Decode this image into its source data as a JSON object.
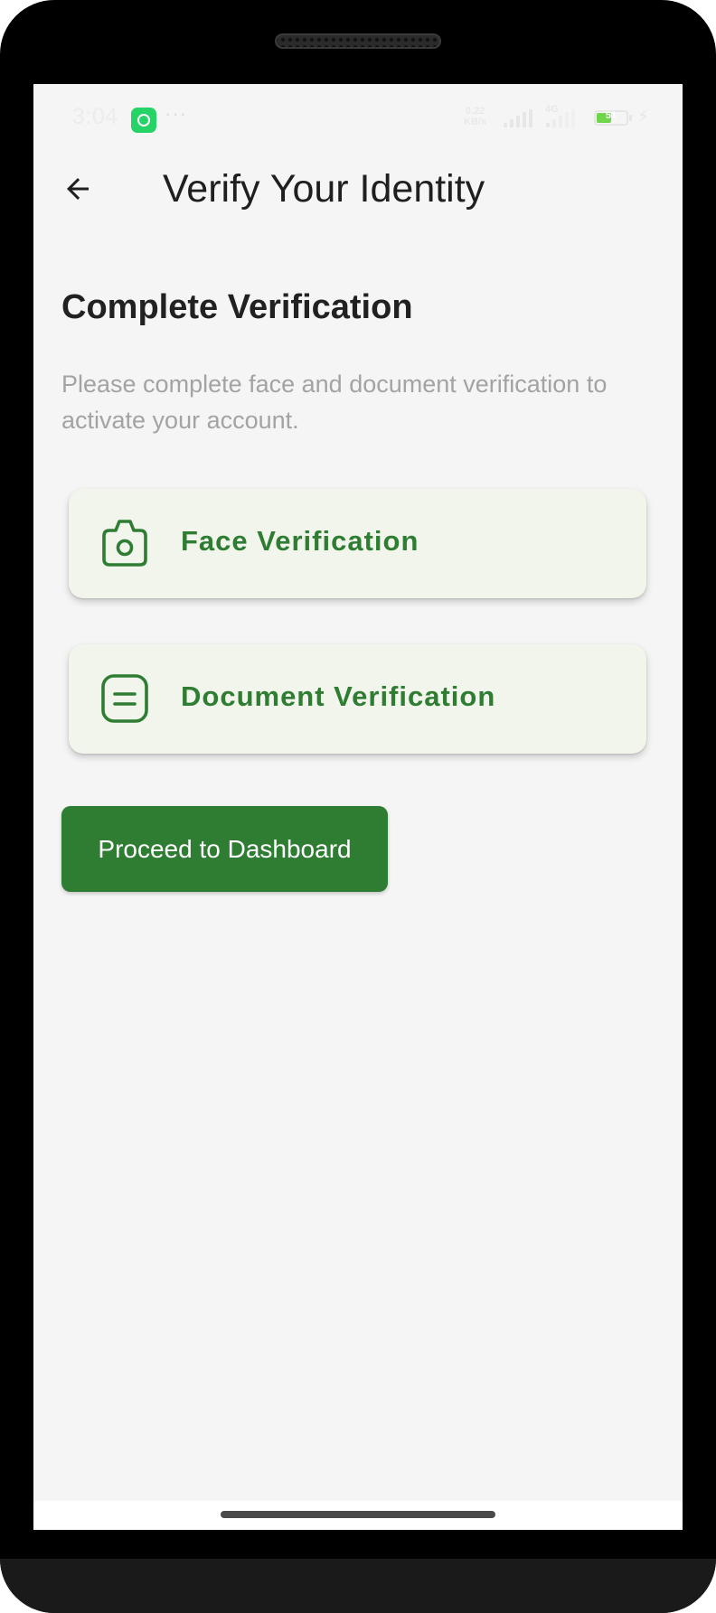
{
  "status_bar": {
    "time": "3:04",
    "notification_icons": [
      "whatsapp-icon"
    ],
    "more_indicator": "···",
    "net_speed_value": "0.22",
    "net_speed_unit": "KB/s",
    "network_type": "4G",
    "battery_percent": "51",
    "battery_level": 0.51,
    "charging": true
  },
  "app_bar": {
    "back_icon": "arrow-left-icon",
    "title": "Verify Your Identity"
  },
  "main": {
    "heading": "Complete Verification",
    "description": "Please complete face and document verification to activate your account.",
    "cards": [
      {
        "icon": "camera-icon",
        "label": "Face Verification"
      },
      {
        "icon": "document-icon",
        "label": "Document Verification"
      }
    ],
    "proceed_button": "Proceed to Dashboard"
  },
  "colors": {
    "accent": "#2e7d32",
    "card_background": "#f2f5ec",
    "screen_background": "#f5f5f5",
    "heading_text": "#212121",
    "description_text": "#a3a3a3"
  }
}
